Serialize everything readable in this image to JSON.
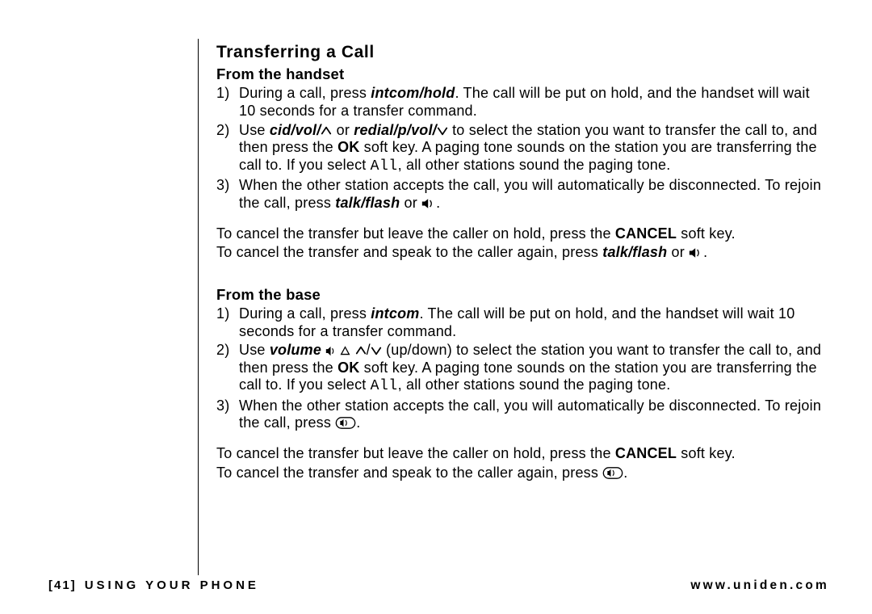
{
  "title": "Transferring a Call",
  "handset": {
    "heading": "From the handset",
    "s1_a": "During a call, press ",
    "s1_key": "intcom/hold",
    "s1_b": ". The call will be put on hold, and the handset will wait 10 seconds for a transfer command.",
    "s2_a": "Use ",
    "s2_key1": "cid/vol/",
    "s2_or": " or ",
    "s2_key2": "redial/p/vol/",
    "s2_b": " to select the station you want to transfer the call to, and then press the ",
    "s2_ok": "OK",
    "s2_c": " soft key. A paging tone sounds on the station you are transferring the call to. If you select ",
    "s2_all": "All",
    "s2_d": ", all other stations sound the paging tone.",
    "s3_a": "When the other station accepts the call, you will automatically be disconnected. To rejoin the call, press ",
    "s3_key": "talk/flash",
    "s3_b": " or ",
    "s3_c": ".",
    "c1_a": "To cancel the transfer but leave the caller on hold, press the ",
    "c1_key": "CANCEL",
    "c1_b": " soft key.",
    "c2_a": "To cancel the transfer and speak to the caller again, press ",
    "c2_key": "talk/flash",
    "c2_b": " or ",
    "c2_c": "."
  },
  "base": {
    "heading": "From the base",
    "s1_a": "During a call, press ",
    "s1_key": "intcom",
    "s1_b": ". The call will be put on hold, and the handset will wait 10 seconds for a transfer command.",
    "s2_a": "Use ",
    "s2_key": "volume",
    "s2_b": " (up/down)  to select the station you want to transfer the call to, and then press the ",
    "s2_ok": "OK",
    "s2_c": " soft key. A paging tone sounds on the station you are transferring the call to. If you select ",
    "s2_all": "All",
    "s2_d": ", all other stations sound the paging tone.",
    "s3_a": "When the other station accepts the call, you will automatically be disconnected. To rejoin the call, press ",
    "s3_b": ".",
    "c1_a": "To cancel the transfer but leave the caller on hold, press the ",
    "c1_key": "CANCEL",
    "c1_b": " soft key.",
    "c2_a": "To cancel the transfer and speak to the caller again, press ",
    "c2_b": "."
  },
  "footer": {
    "page": "[41]",
    "section": "USING YOUR PHONE",
    "url": "www.uniden.com"
  }
}
